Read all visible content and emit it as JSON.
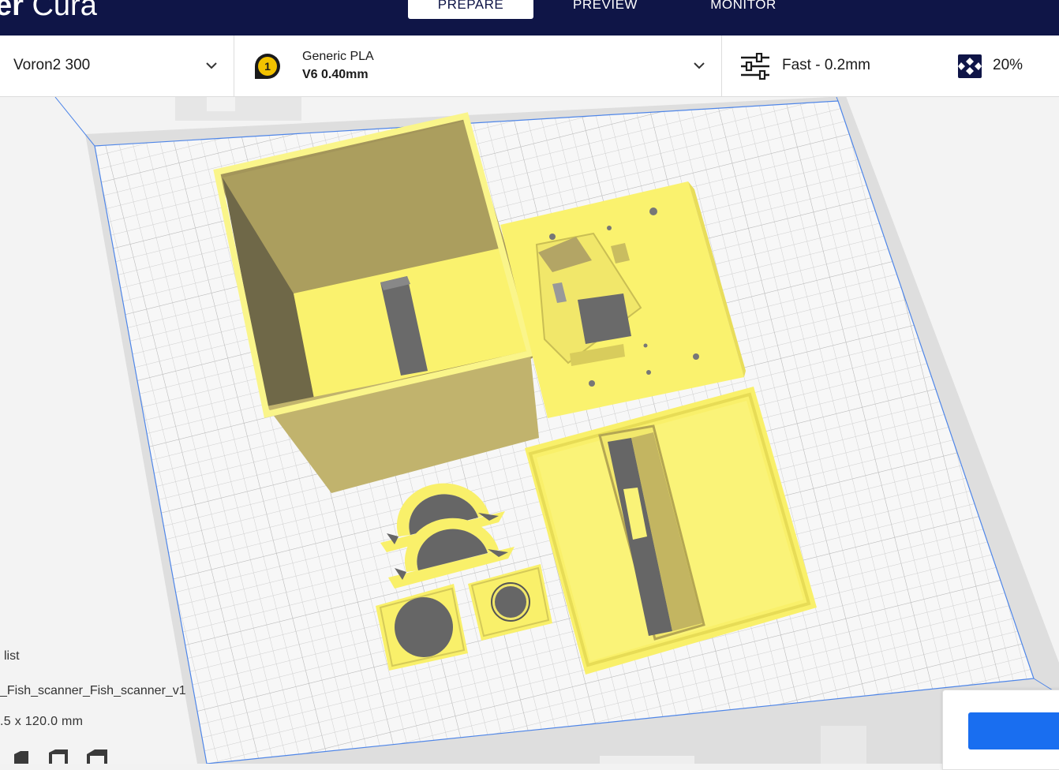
{
  "header": {
    "app_title_bold": "er",
    "app_title_rest": " Cura",
    "stages": [
      {
        "label": "PREPARE",
        "active": true
      },
      {
        "label": "PREVIEW",
        "active": false
      },
      {
        "label": "MONITOR",
        "active": false
      }
    ]
  },
  "setup_bar": {
    "printer": "Voron2 300",
    "extruder_number": "1",
    "material": "Generic PLA",
    "nozzle": "V6 0.40mm",
    "profile": "Fast - 0.2mm",
    "infill": "20%"
  },
  "object_list": {
    "label": "list",
    "file_name": "_Fish_scanner_Fish_scanner_v1",
    "dimensions": ".5 x 120.0 mm"
  },
  "colors": {
    "header_bg": "#0f1547",
    "accent": "#196ef0",
    "model": "#f8f27a",
    "model_shadow": "#a99a5a"
  }
}
